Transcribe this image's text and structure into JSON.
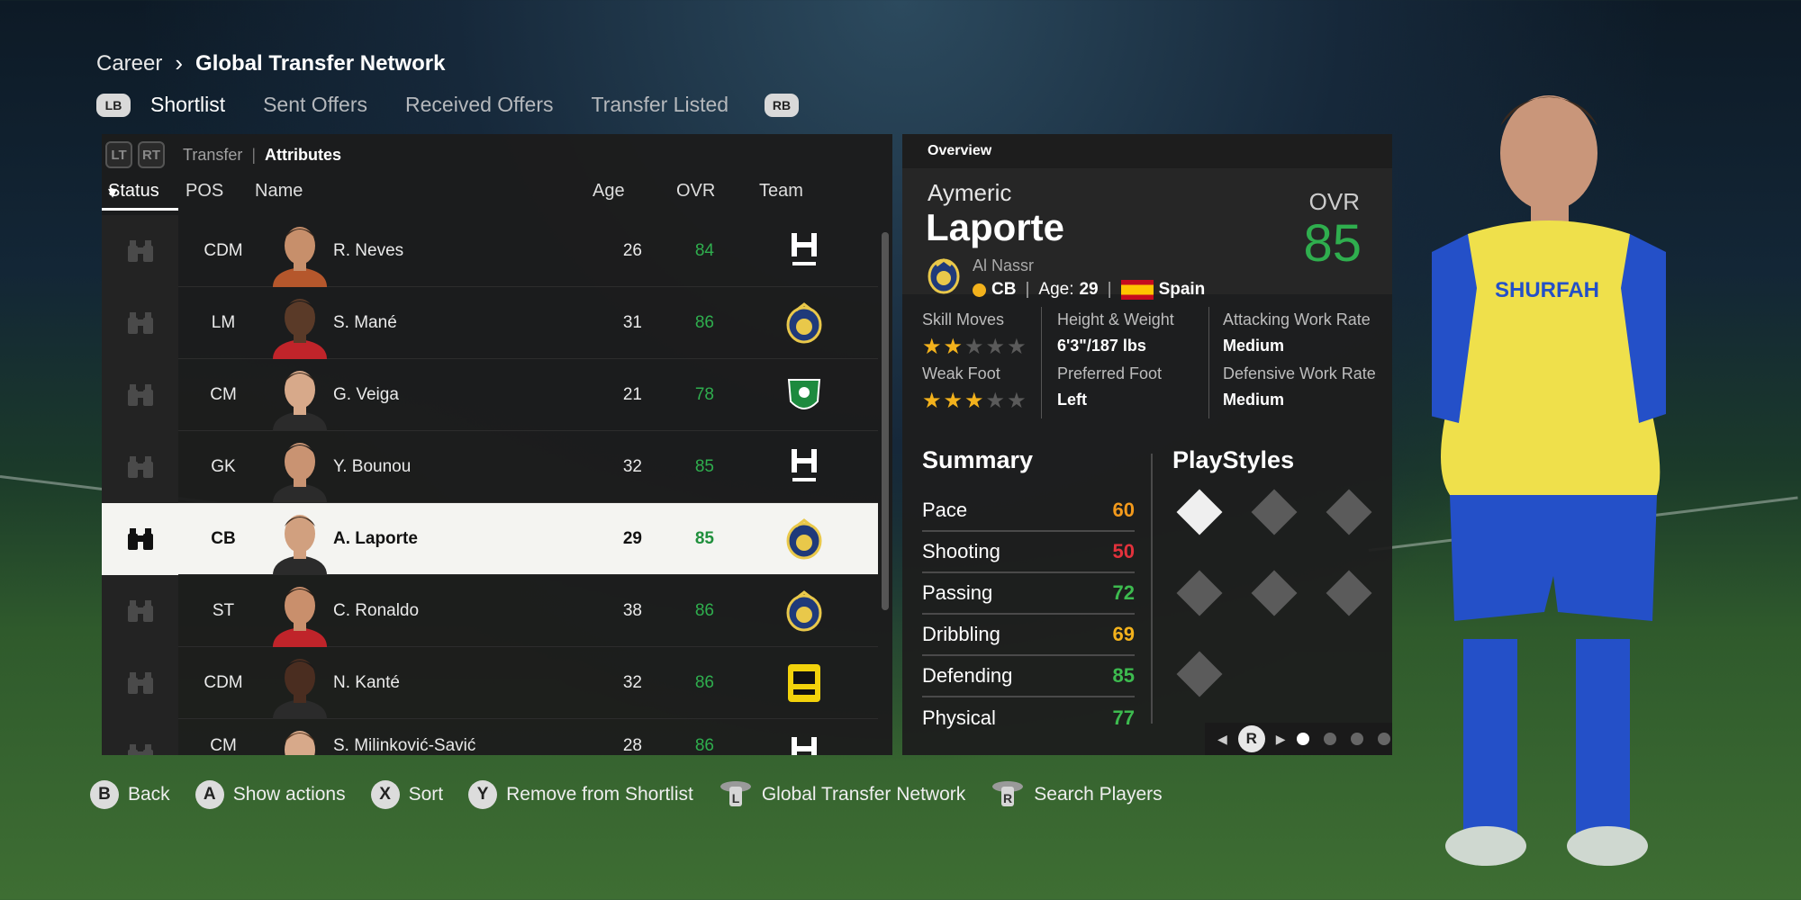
{
  "breadcrumb": {
    "root": "Career",
    "current": "Global Transfer Network"
  },
  "tabs": {
    "lb": "LB",
    "rb": "RB",
    "items": [
      "Shortlist",
      "Sent Offers",
      "Received Offers",
      "Transfer Listed"
    ],
    "active": "Shortlist"
  },
  "sub_tabs": {
    "lt": "LT",
    "rt": "RT",
    "inactive": "Transfer",
    "active": "Attributes"
  },
  "columns": {
    "status": "Status",
    "pos": "POS",
    "name": "Name",
    "age": "Age",
    "ovr": "OVR",
    "team": "Team"
  },
  "players": [
    {
      "pos": "CDM",
      "name": "R. Neves",
      "age": "26",
      "ovr": "84",
      "team": "Al Hilal"
    },
    {
      "pos": "LM",
      "name": "S. Mané",
      "age": "31",
      "ovr": "86",
      "team": "Al Nassr"
    },
    {
      "pos": "CM",
      "name": "G. Veiga",
      "age": "21",
      "ovr": "78",
      "team": "Al Ahli"
    },
    {
      "pos": "GK",
      "name": "Y. Bounou",
      "age": "32",
      "ovr": "85",
      "team": "Al Hilal"
    },
    {
      "pos": "CB",
      "name": "A. Laporte",
      "age": "29",
      "ovr": "85",
      "team": "Al Nassr"
    },
    {
      "pos": "ST",
      "name": "C. Ronaldo",
      "age": "38",
      "ovr": "86",
      "team": "Al Nassr"
    },
    {
      "pos": "CDM",
      "name": "N. Kanté",
      "age": "32",
      "ovr": "86",
      "team": "Al Ittihad"
    },
    {
      "pos": "CM",
      "name": "S. Milinković-Savić",
      "age": "28",
      "ovr": "86",
      "team": "Al Hilal"
    }
  ],
  "selected_index": 4,
  "overview": {
    "header": "Overview",
    "first_name": "Aymeric",
    "last_name": "Laporte",
    "club": "Al Nassr",
    "position": "CB",
    "age_label": "Age:",
    "age": "29",
    "nation": "Spain",
    "ovr_label": "OVR",
    "ovr": "85",
    "skill_moves_label": "Skill Moves",
    "skill_moves_stars": 2,
    "weak_foot_label": "Weak Foot",
    "weak_foot_stars": 3,
    "height_weight_label": "Height & Weight",
    "height_weight": "6'3\"/187 lbs",
    "preferred_foot_label": "Preferred Foot",
    "preferred_foot": "Left",
    "attacking_wr_label": "Attacking Work Rate",
    "attacking_wr": "Medium",
    "defensive_wr_label": "Defensive Work Rate",
    "defensive_wr": "Medium"
  },
  "summary": {
    "title": "Summary",
    "stats": [
      {
        "label": "Pace",
        "value": "60",
        "color": "#f39a1c"
      },
      {
        "label": "Shooting",
        "value": "50",
        "color": "#e3323c"
      },
      {
        "label": "Passing",
        "value": "72",
        "color": "#3dbb4f"
      },
      {
        "label": "Dribbling",
        "value": "69",
        "color": "#f3b21c"
      },
      {
        "label": "Defending",
        "value": "85",
        "color": "#3dbb4f"
      },
      {
        "label": "Physical",
        "value": "77",
        "color": "#3dbb4f"
      }
    ]
  },
  "playstyles": {
    "title": "PlayStyles",
    "count": 7
  },
  "pager": {
    "button": "R",
    "pages": 4,
    "current": 0
  },
  "hints": [
    {
      "btn": "B",
      "label": "Back"
    },
    {
      "btn": "A",
      "label": "Show actions"
    },
    {
      "btn": "X",
      "label": "Sort"
    },
    {
      "btn": "Y",
      "label": "Remove from Shortlist"
    },
    {
      "btn": "L",
      "label": "Global Transfer Network"
    },
    {
      "btn": "R",
      "label": "Search Players"
    }
  ],
  "colors": {
    "ovr_green": "#2fae4e",
    "star_gold": "#f3b21c",
    "selected_row": "#f4f4f1"
  }
}
